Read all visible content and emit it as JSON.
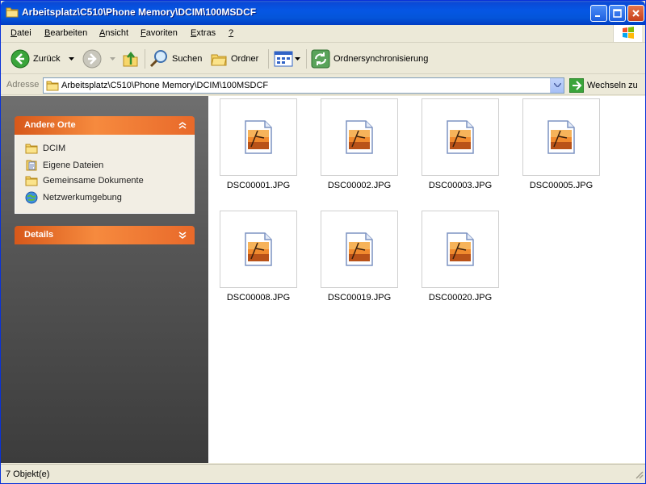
{
  "window": {
    "title": "Arbeitsplatz\\C510\\Phone Memory\\DCIM\\100MSDCF"
  },
  "menu": [
    {
      "label": "Datei",
      "key": "D",
      "rest": "atei"
    },
    {
      "label": "Bearbeiten",
      "key": "B",
      "rest": "earbeiten"
    },
    {
      "label": "Ansicht",
      "key": "A",
      "rest": "nsicht"
    },
    {
      "label": "Favoriten",
      "key": "F",
      "rest": "avoriten"
    },
    {
      "label": "Extras",
      "key": "E",
      "rest": "xtras"
    },
    {
      "label": "?",
      "key": "?",
      "rest": ""
    }
  ],
  "toolbar": {
    "back_label": "Zurück",
    "search_label": "Suchen",
    "folders_label": "Ordner",
    "sync_label": "Ordnersynchronisierung"
  },
  "address": {
    "label": "Adresse",
    "value": "Arbeitsplatz\\C510\\Phone Memory\\DCIM\\100MSDCF",
    "go_label": "Wechseln zu"
  },
  "taskpane": {
    "other_places_title": "Andere Orte",
    "other_places": [
      {
        "label": "DCIM",
        "icon": "folder-icon"
      },
      {
        "label": "Eigene Dateien",
        "icon": "documents-icon"
      },
      {
        "label": "Gemeinsame Dokumente",
        "icon": "folder-icon"
      },
      {
        "label": "Netzwerkumgebung",
        "icon": "network-icon"
      }
    ],
    "details_title": "Details"
  },
  "files": [
    {
      "name": "DSC00001.JPG"
    },
    {
      "name": "DSC00002.JPG"
    },
    {
      "name": "DSC00003.JPG"
    },
    {
      "name": "DSC00005.JPG"
    },
    {
      "name": "DSC00008.JPG"
    },
    {
      "name": "DSC00019.JPG"
    },
    {
      "name": "DSC00020.JPG"
    }
  ],
  "status": {
    "text": "7 Objekt(e)"
  },
  "colors": {
    "titlebar": "#0455d9",
    "taskpane_header": "#f68a3e",
    "taskpane_bg": "#565656"
  }
}
